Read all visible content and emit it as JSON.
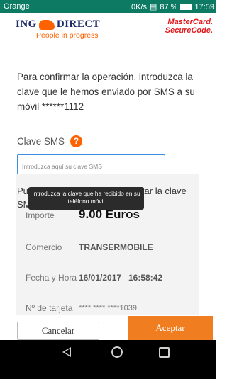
{
  "status_bar": {
    "carrier": "Orange",
    "speed": "0K/s",
    "battery": "87 %",
    "time": "17:59"
  },
  "header": {
    "logo_text": "ING DIRECT",
    "tagline": "People in progress",
    "mastercard": "MasterCard.",
    "securecode": "SecureCode."
  },
  "intro": "Para confirmar la operación, introduzca la clave que le hemos enviado por SMS a su móvil ******1112",
  "sms": {
    "label": "Clave SMS",
    "help": "?",
    "placeholder": "Introduzca aquí su clave SMS",
    "tooltip": "Introduzca la clave que ha recibido en su teléfono móvil",
    "info_prefix": "Pul",
    "info_suffix": "ultar la clave",
    "info_line2": "SMS en la web",
    "info_link": "ltar"
  },
  "details": {
    "importe_label": "Importe",
    "importe_value": "9.00 Euros",
    "comercio_label": "Comercio",
    "comercio_value": "TRANSERMOBILE",
    "fecha_label": "Fecha y Hora",
    "fecha_value": "16/01/2017",
    "hora_value": "16:58:42",
    "tarjeta_label": "Nº de tarjeta",
    "tarjeta_value": "**** **** ****1039"
  },
  "buttons": {
    "cancel": "Cancelar",
    "accept": "Aceptar"
  },
  "colors": {
    "accent": "#ff6200",
    "status_bar": "#0d7a63",
    "accept_button": "#f07d1f"
  }
}
